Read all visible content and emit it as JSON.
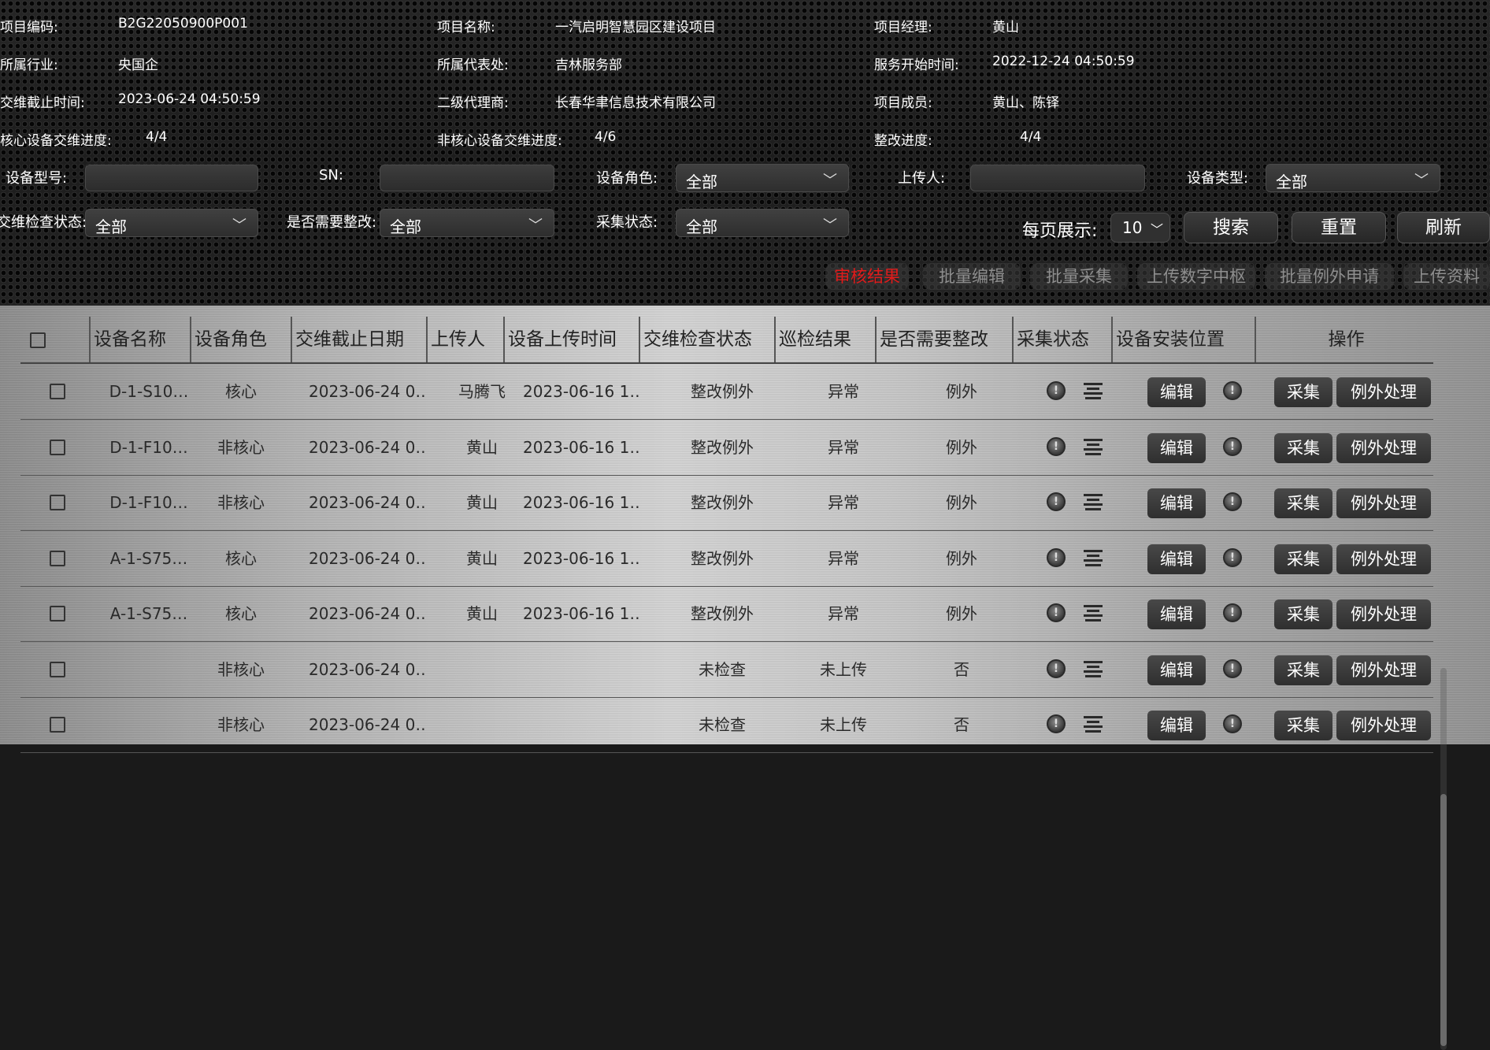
{
  "info": {
    "project_code_label": "项目编码:",
    "project_code": "B2G22050900P001",
    "project_name_label": "项目名称:",
    "project_name": "一汽启明智慧园区建设项目",
    "manager_label": "项目经理:",
    "manager": "黄山",
    "industry_label": "所属行业:",
    "industry": "央国企",
    "office_label": "所属代表处:",
    "office": "吉林服务部",
    "start_label": "服务开始时间:",
    "start": "2022-12-24 04:50:59",
    "deadline_label": "交维截止时间:",
    "deadline": "2023-06-24 04:50:59",
    "agent_label": "二级代理商:",
    "agent": "长春华聿信息技术有限公司",
    "members_label": "项目成员:",
    "members": "黄山、陈铎",
    "core_label": "核心设备交维进度:",
    "core": "4/4",
    "noncore_label": "非核心设备交维进度:",
    "noncore": "4/6",
    "rectify_label": "整改进度:",
    "rectify": "4/4"
  },
  "filters": {
    "model_label": "设备型号:",
    "sn_label": "SN:",
    "role_label": "设备角色:",
    "role_value": "全部",
    "uploader_label": "上传人:",
    "type_label": "设备类型:",
    "type_value": "全部",
    "check_label": "交维检查状态:",
    "check_value": "全部",
    "need_label": "是否需要整改:",
    "need_value": "全部",
    "collect_label": "采集状态:",
    "collect_value": "全部",
    "per_page_label": "每页展示:",
    "per_page_value": "10",
    "search": "搜索",
    "reset": "重置",
    "refresh": "刷新"
  },
  "actions": [
    "审核结果",
    "批量编辑",
    "批量采集",
    "上传数字中枢",
    "批量例外申请",
    "上传资料"
  ],
  "table": {
    "headers": [
      "设备名称",
      "设备角色",
      "交维截止日期",
      "上传人",
      "设备上传时间",
      "交维检查状态",
      "巡检结果",
      "是否需要整改",
      "采集状态",
      "设备安装位置",
      "操作"
    ],
    "edit_label": "编辑",
    "collect_label": "采集",
    "exception_label": "例外处理",
    "rows": [
      {
        "name": "D-1-S10…",
        "role": "核心",
        "deadline": "2023-06-24 0…",
        "uploader": "马腾飞",
        "upload_time": "2023-06-16 1…",
        "check": "整改例外",
        "inspect": "异常",
        "need": "例外"
      },
      {
        "name": "D-1-F10…",
        "role": "非核心",
        "deadline": "2023-06-24 0…",
        "uploader": "黄山",
        "upload_time": "2023-06-16 1…",
        "check": "整改例外",
        "inspect": "异常",
        "need": "例外"
      },
      {
        "name": "D-1-F10…",
        "role": "非核心",
        "deadline": "2023-06-24 0…",
        "uploader": "黄山",
        "upload_time": "2023-06-16 1…",
        "check": "整改例外",
        "inspect": "异常",
        "need": "例外"
      },
      {
        "name": "A-1-S75…",
        "role": "核心",
        "deadline": "2023-06-24 0…",
        "uploader": "黄山",
        "upload_time": "2023-06-16 1…",
        "check": "整改例外",
        "inspect": "异常",
        "need": "例外"
      },
      {
        "name": "A-1-S75…",
        "role": "核心",
        "deadline": "2023-06-24 0…",
        "uploader": "黄山",
        "upload_time": "2023-06-16 1…",
        "check": "整改例外",
        "inspect": "异常",
        "need": "例外"
      },
      {
        "name": "",
        "role": "非核心",
        "deadline": "2023-06-24 0…",
        "uploader": "",
        "upload_time": "",
        "check": "未检查",
        "inspect": "未上传",
        "need": "否"
      },
      {
        "name": "",
        "role": "非核心",
        "deadline": "2023-06-24 0…",
        "uploader": "",
        "upload_time": "",
        "check": "未检查",
        "inspect": "未上传",
        "need": "否"
      }
    ]
  },
  "colors": {
    "active_action": "#e01b1b",
    "inactive_action": "#8e8e8e"
  }
}
